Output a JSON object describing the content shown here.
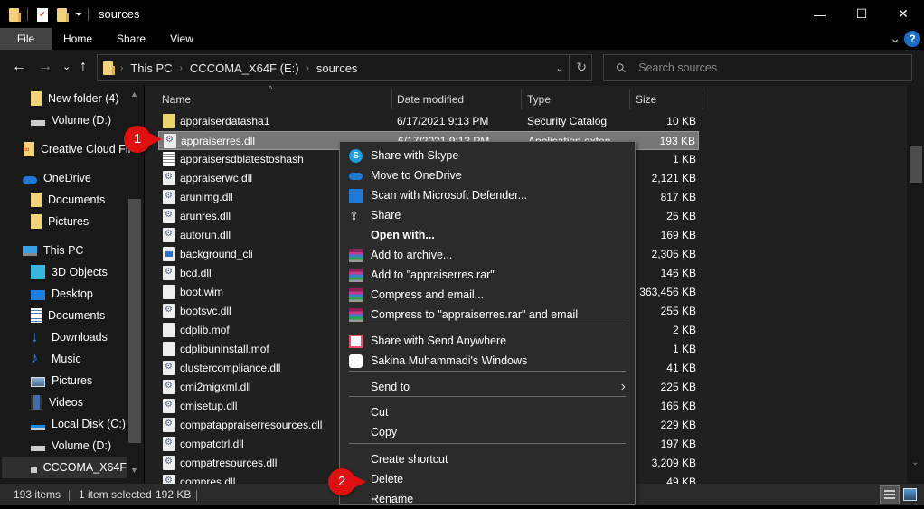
{
  "window": {
    "title": "sources",
    "minimize": "—",
    "maximize": "☐",
    "close": "✕"
  },
  "ribbon": {
    "tabs": [
      "File",
      "Home",
      "Share",
      "View"
    ],
    "expand": "⌄",
    "help": "?"
  },
  "nav": {
    "back": "←",
    "forward": "→",
    "recent": "⌄",
    "up": "↑",
    "breadcrumb": [
      "This PC",
      "CCCOMA_X64F (E:)",
      "sources"
    ],
    "crumb_sep": "›",
    "dropdown": "⌄",
    "refresh": "↻",
    "search_placeholder": "Search sources",
    "search_icon": "⚲"
  },
  "sidebar": {
    "items": [
      {
        "label": "New folder (4)",
        "icon": "folder-icon"
      },
      {
        "label": "Volume (D:)",
        "icon": "drive-icon"
      },
      {
        "label": "Creative Cloud Fil",
        "icon": "creative-cloud-icon"
      },
      {
        "label": "OneDrive",
        "icon": "onedrive-icon"
      },
      {
        "label": "Documents",
        "icon": "folder-icon"
      },
      {
        "label": "Pictures",
        "icon": "folder-icon"
      },
      {
        "label": "This PC",
        "icon": "pc-icon"
      },
      {
        "label": "3D Objects",
        "icon": "3d-objects-icon"
      },
      {
        "label": "Desktop",
        "icon": "desktop-icon"
      },
      {
        "label": "Documents",
        "icon": "documents-icon"
      },
      {
        "label": "Downloads",
        "icon": "downloads-icon"
      },
      {
        "label": "Music",
        "icon": "music-icon"
      },
      {
        "label": "Pictures",
        "icon": "pictures-icon"
      },
      {
        "label": "Videos",
        "icon": "videos-icon"
      },
      {
        "label": "Local Disk (C:)",
        "icon": "local-disk-icon"
      },
      {
        "label": "Volume (D:)",
        "icon": "drive-icon"
      },
      {
        "label": "CCCOMA_X64F",
        "icon": "drive-icon"
      }
    ]
  },
  "columns": {
    "name": "Name",
    "date": "Date modified",
    "type": "Type",
    "size": "Size"
  },
  "files": [
    {
      "name": "appraiserdatasha1",
      "date": "6/17/2021 9:13 PM",
      "type": "Security Catalog",
      "size": "10 KB",
      "icon": "cat"
    },
    {
      "name": "appraiserres.dll",
      "date": "6/17/2021 9:13 PM",
      "type": "Application exten",
      "size": "193 KB",
      "icon": "dll",
      "selected": true
    },
    {
      "name": "appraisersdblatestoshash",
      "date": "",
      "type": "",
      "size": "1 KB",
      "icon": "txt"
    },
    {
      "name": "appraiserwc.dll",
      "date": "",
      "type": "",
      "size": "2,121 KB",
      "icon": "dll"
    },
    {
      "name": "arunimg.dll",
      "date": "",
      "type": "",
      "size": "817 KB",
      "icon": "dll"
    },
    {
      "name": "arunres.dll",
      "date": "",
      "type": "",
      "size": "25 KB",
      "icon": "dll"
    },
    {
      "name": "autorun.dll",
      "date": "",
      "type": "",
      "size": "169 KB",
      "icon": "dll"
    },
    {
      "name": "background_cli",
      "date": "",
      "type": "",
      "size": "2,305 KB",
      "icon": "img"
    },
    {
      "name": "bcd.dll",
      "date": "",
      "type": "",
      "size": "146 KB",
      "icon": "dll"
    },
    {
      "name": "boot.wim",
      "date": "",
      "type": "",
      "size": "363,456 KB",
      "icon": "blank"
    },
    {
      "name": "bootsvc.dll",
      "date": "",
      "type": "",
      "size": "255 KB",
      "icon": "dll"
    },
    {
      "name": "cdplib.mof",
      "date": "",
      "type": "",
      "size": "2 KB",
      "icon": "blank"
    },
    {
      "name": "cdplibuninstall.mof",
      "date": "",
      "type": "",
      "size": "1 KB",
      "icon": "blank"
    },
    {
      "name": "clustercompliance.dll",
      "date": "",
      "type": "",
      "size": "41 KB",
      "icon": "dll"
    },
    {
      "name": "cmi2migxml.dll",
      "date": "",
      "type": "",
      "size": "225 KB",
      "icon": "dll"
    },
    {
      "name": "cmisetup.dll",
      "date": "",
      "type": "",
      "size": "165 KB",
      "icon": "dll"
    },
    {
      "name": "compatappraiserresources.dll",
      "date": "",
      "type": "",
      "size": "229 KB",
      "icon": "dll"
    },
    {
      "name": "compatctrl.dll",
      "date": "",
      "type": "",
      "size": "197 KB",
      "icon": "dll"
    },
    {
      "name": "compatresources.dll",
      "date": "",
      "type": "",
      "size": "3,209 KB",
      "icon": "dll"
    },
    {
      "name": "compres.dll",
      "date": "",
      "type": "",
      "size": "49 KB",
      "icon": "dll"
    }
  ],
  "context_menu": {
    "items": [
      {
        "label": "Share with Skype",
        "icon": "skype-icon"
      },
      {
        "label": "Move to OneDrive",
        "icon": "onedrive-icon"
      },
      {
        "label": "Scan with Microsoft Defender...",
        "icon": "defender-icon"
      },
      {
        "label": "Share",
        "icon": "share-icon"
      },
      {
        "label": "Open with...",
        "icon": "",
        "bold": true
      },
      {
        "label": "Add to archive...",
        "icon": "winrar-icon"
      },
      {
        "label": "Add to \"appraiserres.rar\"",
        "icon": "winrar-icon"
      },
      {
        "label": "Compress and email...",
        "icon": "winrar-icon"
      },
      {
        "label": "Compress to \"appraiserres.rar\" and email",
        "icon": "winrar-icon"
      },
      {
        "label": "Share with Send Anywhere",
        "icon": "send-anywhere-icon"
      },
      {
        "label": "Sakina Muhammadi's Windows",
        "icon": "windows-device-icon"
      },
      {
        "label": "Send to",
        "icon": "",
        "submenu": "›"
      },
      {
        "label": "Cut",
        "icon": ""
      },
      {
        "label": "Copy",
        "icon": ""
      },
      {
        "label": "Create shortcut",
        "icon": ""
      },
      {
        "label": "Delete",
        "icon": ""
      },
      {
        "label": "Rename",
        "icon": ""
      }
    ]
  },
  "annotations": [
    {
      "label": "1"
    },
    {
      "label": "2"
    }
  ],
  "status": {
    "items": "193 items",
    "selected": "1 item selected",
    "size": "192 KB",
    "sep": "|"
  }
}
